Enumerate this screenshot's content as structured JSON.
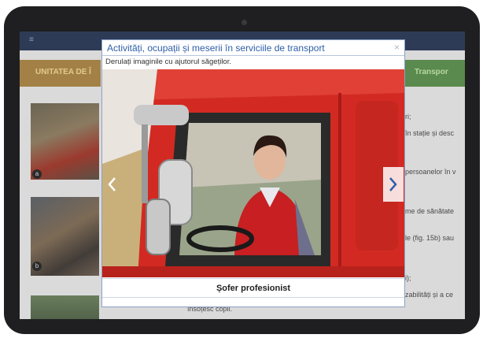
{
  "background_page": {
    "header_title": "",
    "left_tab": "UNITATEA DE Î",
    "right_tab": "Transpor",
    "text_lines": [
      "ri;",
      "în stație și desc",
      "persoanelor în v",
      "me de sănătate",
      "le (fig. 15b) sau",
      "i);",
      "zabilități și a ce",
      "însoțesc copii."
    ],
    "photo_numbers": [
      "a",
      "b"
    ]
  },
  "modal": {
    "title": "Activități, ocupații și meserii în serviciile de transport",
    "close_label": "×",
    "instruction": "Derulați imaginile cu ajutorul săgeților.",
    "caption": "Șofer profesionist",
    "prev_icon": "chevron-left-icon",
    "next_icon": "chevron-right-icon"
  },
  "colors": {
    "accent": "#2f5fa8",
    "truck_red": "#d22a22",
    "vest_red": "#c81f22"
  }
}
